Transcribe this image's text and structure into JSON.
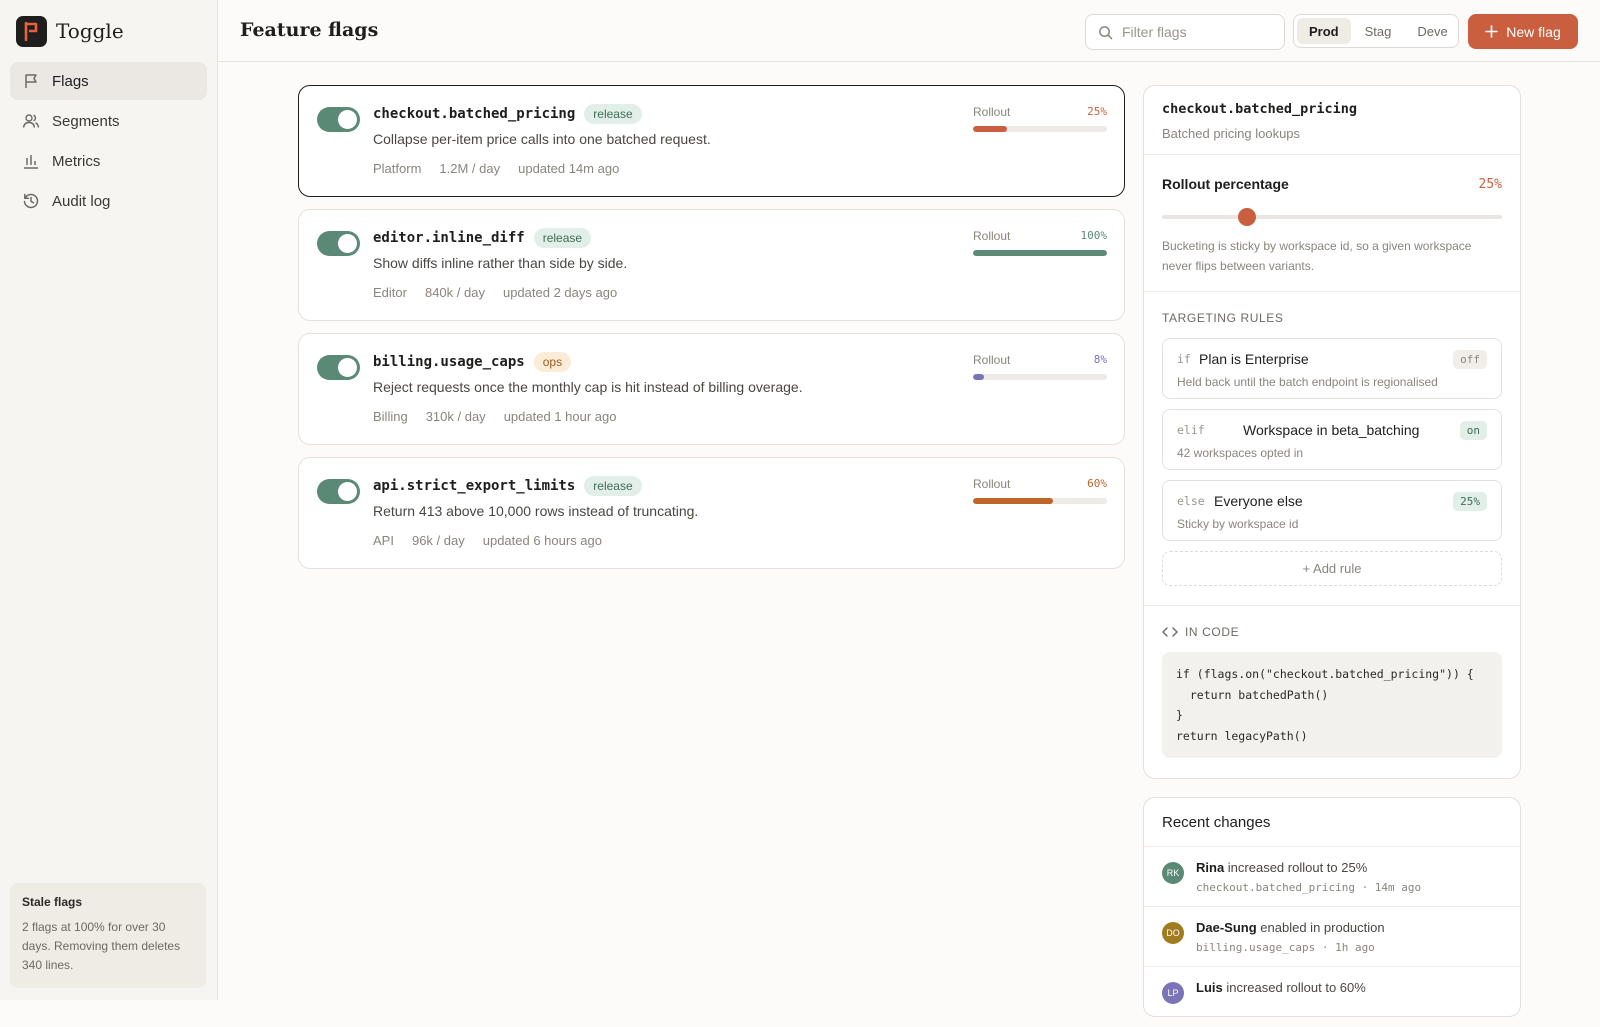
{
  "app": {
    "name": "Toggle"
  },
  "sidebar": {
    "items": [
      {
        "label": "Flags",
        "icon": "flag-icon",
        "active": true
      },
      {
        "label": "Segments",
        "icon": "users-icon",
        "active": false
      },
      {
        "label": "Metrics",
        "icon": "bar-chart-icon",
        "active": false
      },
      {
        "label": "Audit log",
        "icon": "history-icon",
        "active": false
      }
    ],
    "stale": {
      "title": "Stale flags",
      "text": "2 flags at 100% for over 30 days. Removing them deletes 340 lines."
    }
  },
  "header": {
    "title": "Feature flags",
    "search_placeholder": "Filter flags",
    "envs": [
      "Prod",
      "Stag",
      "Deve"
    ],
    "active_env": "Prod",
    "new_button": "New flag",
    "accent": "#c95f3e"
  },
  "flags": [
    {
      "name": "checkout.batched_pricing",
      "tag": "release",
      "description": "Collapse per-item price calls into one batched request.",
      "team": "Platform",
      "volume": "1.2M / day",
      "updated": "updated 14m ago",
      "rollout_label": "Rollout",
      "rollout": 25,
      "rollout_text": "25%",
      "color": "#c95f3e",
      "enabled": true,
      "selected": true
    },
    {
      "name": "editor.inline_diff",
      "tag": "release",
      "description": "Show diffs inline rather than side by side.",
      "team": "Editor",
      "volume": "840k / day",
      "updated": "updated 2 days ago",
      "rollout_label": "Rollout",
      "rollout": 100,
      "rollout_text": "100%",
      "color": "#5a8a75",
      "enabled": true,
      "selected": false
    },
    {
      "name": "billing.usage_caps",
      "tag": "ops",
      "description": "Reject requests once the monthly cap is hit instead of billing overage.",
      "team": "Billing",
      "volume": "310k / day",
      "updated": "updated 1 hour ago",
      "rollout_label": "Rollout",
      "rollout": 8,
      "rollout_text": "8%",
      "color": "#7b74b8",
      "enabled": true,
      "selected": false
    },
    {
      "name": "api.strict_export_limits",
      "tag": "release",
      "description": "Return 413 above 10,000 rows instead of truncating.",
      "team": "API",
      "volume": "96k / day",
      "updated": "updated 6 hours ago",
      "rollout_label": "Rollout",
      "rollout": 60,
      "rollout_text": "60%",
      "color": "#c0652a",
      "enabled": true,
      "selected": false
    }
  ],
  "detail": {
    "flag_name": "checkout.batched_pricing",
    "subtitle": "Batched pricing lookups",
    "rollout_label": "Rollout percentage",
    "rollout": 25,
    "rollout_text": "25%",
    "note": "Bucketing is sticky by workspace id, so a given workspace never flips between variants.",
    "rules_caption": "TARGETING RULES",
    "rules": [
      {
        "keyword": "if",
        "title": "Plan is Enterprise",
        "desc": "Held back until the batch endpoint is regionalised",
        "badge": "off",
        "badge_kind": "off"
      },
      {
        "keyword": "elif",
        "title": "Workspace in beta_batching",
        "desc": "42 workspaces opted in",
        "badge": "on",
        "badge_kind": "on"
      },
      {
        "keyword": "else",
        "title": "Everyone else",
        "desc": "Sticky by workspace id",
        "badge": "25%",
        "badge_kind": "on"
      }
    ],
    "add_rule": "+ Add rule",
    "code_caption": "IN CODE",
    "code": "if (flags.on(\"checkout.batched_pricing\")) {\n  return batchedPath()\n}\nreturn legacyPath()"
  },
  "recent": {
    "title": "Recent changes",
    "items": [
      {
        "initials": "RK",
        "color": "#5a8a75",
        "user": "Rina",
        "action": "increased rollout to 25%",
        "meta": "checkout.batched_pricing · 14m ago"
      },
      {
        "initials": "DO",
        "color": "#a07c1e",
        "user": "Dae-Sung",
        "action": "enabled in production",
        "meta": "billing.usage_caps · 1h ago"
      },
      {
        "initials": "LP",
        "color": "#7b74b8",
        "user": "Luis",
        "action": "increased rollout to 60%",
        "meta": ""
      }
    ]
  }
}
